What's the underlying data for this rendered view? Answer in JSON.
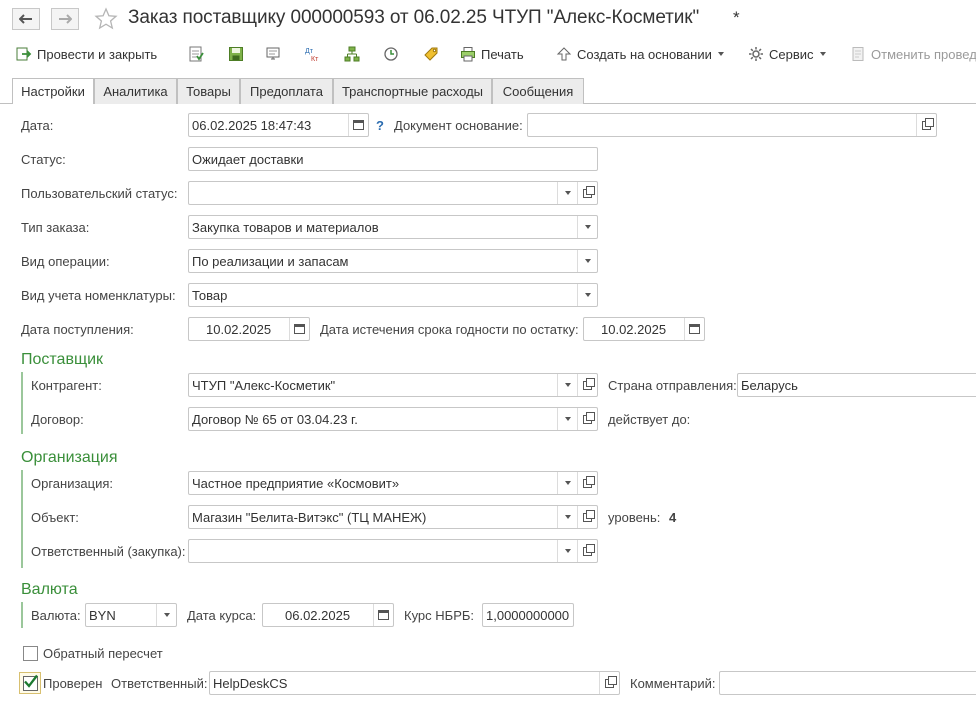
{
  "window": {
    "title": "Заказ поставщику 000000593 от 06.02.25 ЧТУП  \"Алекс-Косметик\"",
    "modified_mark": "*"
  },
  "toolbar": {
    "post_and_close": "Провести и закрыть",
    "print": "Печать",
    "create_based_on": "Создать на основании",
    "service": "Сервис",
    "cancel_posting": "Отменить провед",
    "dtkt_top": "Дт",
    "dtkt_bottom": "Кт"
  },
  "tabs": [
    "Настройки",
    "Аналитика",
    "Товары",
    "Предоплата",
    "Транспортные расходы",
    "Сообщения"
  ],
  "form": {
    "date_label": "Дата:",
    "date_value": "06.02.2025 18:47:43",
    "help_mark": "?",
    "base_doc_label": "Документ основание:",
    "base_doc_value": "",
    "status_label": "Статус:",
    "status_value": "Ожидает доставки",
    "user_status_label": "Пользовательский статус:",
    "user_status_value": "",
    "order_type_label": "Тип заказа:",
    "order_type_value": "Закупка товаров и материалов",
    "operation_label": "Вид операции:",
    "operation_value": "По реализации и запасам",
    "accounting_label": "Вид учета номенклатуры:",
    "accounting_value": "Товар",
    "receipt_date_label": "Дата  поступления:",
    "receipt_date_value": "10.02.2025",
    "expiry_label": "Дата истечения срока годности по остатку:",
    "expiry_value": "10.02.2025"
  },
  "supplier": {
    "title": "Поставщик",
    "counterparty_label": "Контрагент:",
    "counterparty_value": "ЧТУП  \"Алекс-Косметик\"",
    "country_label": "Страна отправления:",
    "country_value": "Беларусь",
    "contract_label": "Договор:",
    "contract_value": "Договор № 65 от 03.04.23 г.",
    "valid_until_label": "действует до:"
  },
  "organization": {
    "title": "Организация",
    "org_label": "Организация:",
    "org_value": "Частное предприятие «Космовит»",
    "object_label": "Объект:",
    "object_value": "Магазин \"Белита-Витэкс\" (ТЦ МАНЕЖ)",
    "level_label": "уровень:",
    "level_value": "4",
    "responsible_label": "Ответственный (закупка):",
    "responsible_value": ""
  },
  "currency": {
    "title": "Валюта",
    "currency_label": "Валюта:",
    "currency_value": "BYN",
    "rate_date_label": "Дата курса:",
    "rate_date_value": "06.02.2025",
    "rate_label": "Курс НБРБ:",
    "rate_value": "1,0000000000"
  },
  "bottom": {
    "reverse_calc_label": "Обратный пересчет",
    "reverse_calc_checked": false,
    "checked_label": "Проверен",
    "checked_checked": true,
    "responsible_label": "Ответственный:",
    "responsible_value": "HelpDeskCS",
    "comment_label": "Комментарий:",
    "comment_value": ""
  },
  "colors": {
    "group_title": "#3a8f3a",
    "group_bar": "#9bc79b",
    "help_mark": "#2b6cb0"
  }
}
